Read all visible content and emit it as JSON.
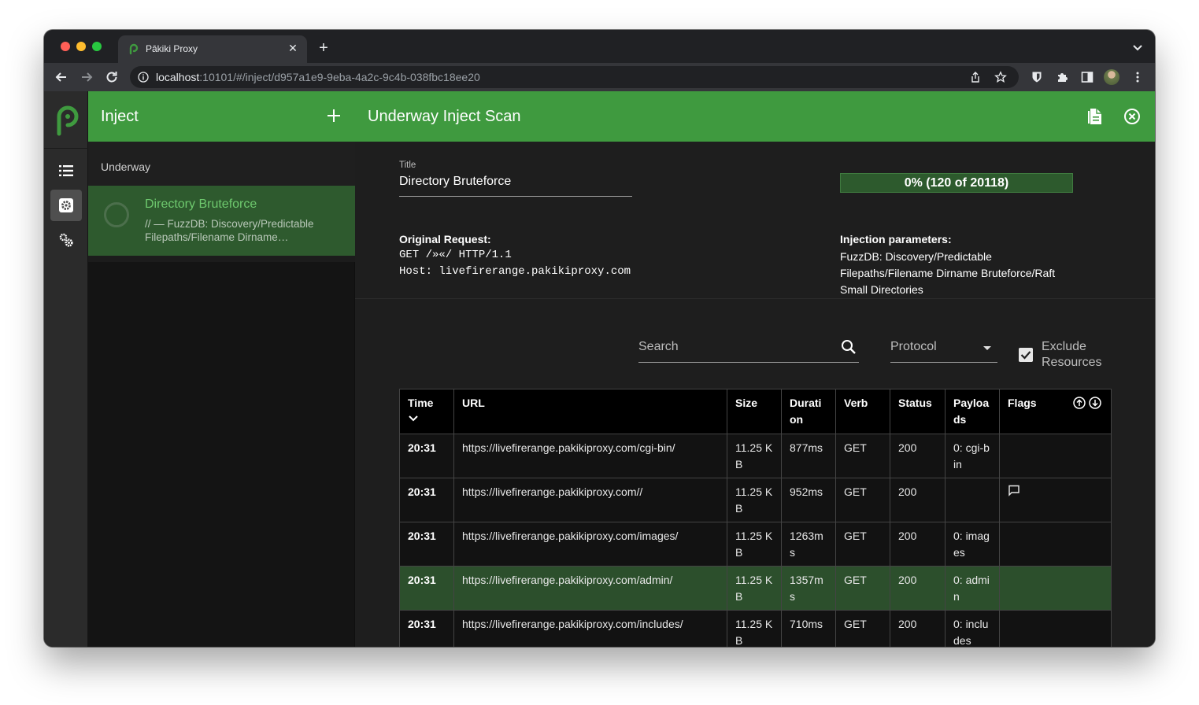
{
  "browser": {
    "tab_title": "Pākiki Proxy",
    "url_host": "localhost",
    "url_path": ":10101/#/inject/d957a1e9-9eba-4a2c-9c4b-038fbc18ee20"
  },
  "colors": {
    "brand_green": "#3f9a3f",
    "selected_row": "#2c4f2c",
    "accent_text": "#6ec96e"
  },
  "rail": {
    "items": [
      {
        "icon": "list-icon"
      },
      {
        "icon": "gear-icon",
        "active": true
      },
      {
        "icon": "cogs-icon"
      }
    ]
  },
  "list": {
    "title": "Inject",
    "group": "Underway",
    "items": [
      {
        "title": "Directory Bruteforce",
        "subtitle": "// — FuzzDB: Discovery/Predictable Filepaths/Filename Dirname…"
      }
    ]
  },
  "main": {
    "title": "Underway Inject Scan",
    "title_label": "Title",
    "title_value": "Directory Bruteforce",
    "progress_text": "0% (120 of 20118)",
    "progress_fraction": 0.006,
    "original_request_label": "Original Request:",
    "request_line_1": "GET /»«/ HTTP/1.1",
    "request_line_2": "Host: livefirerange.pakikiproxy.com",
    "injection_label": "Injection parameters:",
    "injection_value": "FuzzDB: Discovery/Predictable Filepaths/Filename Dirname Bruteforce/Raft Small Directories"
  },
  "filters": {
    "search_placeholder": "Search",
    "protocol_placeholder": "Protocol",
    "exclude_label": "Exclude Resources",
    "exclude_checked": true
  },
  "table": {
    "headers": {
      "time": "Time",
      "url": "URL",
      "size": "Size",
      "duration": "Duration",
      "verb": "Verb",
      "status": "Status",
      "payloads": "Payloads",
      "flags": "Flags"
    },
    "rows": [
      {
        "time": "20:31",
        "url": "https://livefirerange.pakikiproxy.com/cgi-bin/",
        "size": "11.25 KB",
        "duration": "877ms",
        "verb": "GET",
        "status": "200",
        "payloads": "0: cgi-bin",
        "flag": ""
      },
      {
        "time": "20:31",
        "url": "https://livefirerange.pakikiproxy.com//",
        "size": "11.25 KB",
        "duration": "952ms",
        "verb": "GET",
        "status": "200",
        "payloads": "",
        "flag": "comment-icon"
      },
      {
        "time": "20:31",
        "url": "https://livefirerange.pakikiproxy.com/images/",
        "size": "11.25 KB",
        "duration": "1263ms",
        "verb": "GET",
        "status": "200",
        "payloads": "0: images",
        "flag": ""
      },
      {
        "time": "20:31",
        "url": "https://livefirerange.pakikiproxy.com/admin/",
        "size": "11.25 KB",
        "duration": "1357ms",
        "verb": "GET",
        "status": "200",
        "payloads": "0: admin",
        "flag": "",
        "selected": true
      },
      {
        "time": "20:31",
        "url": "https://livefirerange.pakikiproxy.com/includes/",
        "size": "11.25 KB",
        "duration": "710ms",
        "verb": "GET",
        "status": "200",
        "payloads": "0: includes",
        "flag": ""
      }
    ]
  }
}
